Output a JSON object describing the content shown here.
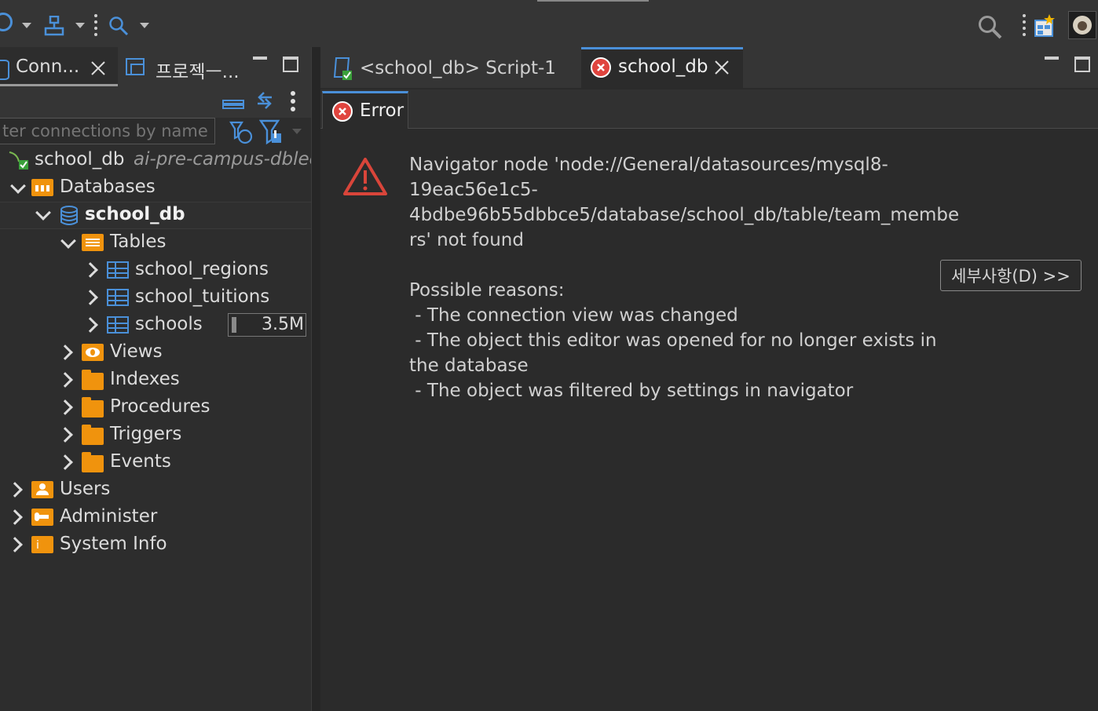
{
  "colors": {
    "accent": "#4a90d9",
    "error_red": "#e0443e",
    "folder_orange": "#f0930d",
    "warning_red": "#d9453a"
  },
  "toolbar": {
    "icons": [
      "database-connect-icon",
      "network-icon",
      "search-icon",
      "global-search-icon",
      "perspective-icon",
      "avatar"
    ]
  },
  "left_tabs": [
    {
      "label": "Conn...",
      "icon": "database-icon",
      "active": true
    },
    {
      "label": "프로젝ㅡ...",
      "icon": "project-icon",
      "active": false
    }
  ],
  "filter": {
    "placeholder": "ter connections by name"
  },
  "tree": {
    "connection": {
      "name": "school_db",
      "host": "ai-pre-campus-dblec"
    },
    "databases_label": "Databases",
    "schema_label": "school_db",
    "tables_label": "Tables",
    "tables": [
      {
        "name": "school_regions"
      },
      {
        "name": "school_tuitions"
      },
      {
        "name": "schools",
        "size": "3.5M"
      }
    ],
    "folders": [
      "Views",
      "Indexes",
      "Procedures",
      "Triggers",
      "Events"
    ],
    "root_items": [
      "Users",
      "Administer",
      "System Info"
    ]
  },
  "editor_tabs": [
    {
      "label": "<school_db> Script-1",
      "active": false
    },
    {
      "label": "school_db",
      "active": true
    }
  ],
  "subtab": {
    "label": "Error"
  },
  "error": {
    "message_lines": [
      "Navigator node 'node://General/datasources/mysql8-",
      "19eac56e1c5-",
      "4bdbe96b55dbbce5/database/school_db/table/team_membe",
      "rs' not found"
    ],
    "reasons_title": "Possible reasons:",
    "reasons_lines": [
      " - The connection view was changed",
      " - The object this editor was opened for no longer exists in",
      "the database",
      " - The object was filtered by settings in navigator"
    ],
    "details_button": "세부사항(D) >>"
  }
}
